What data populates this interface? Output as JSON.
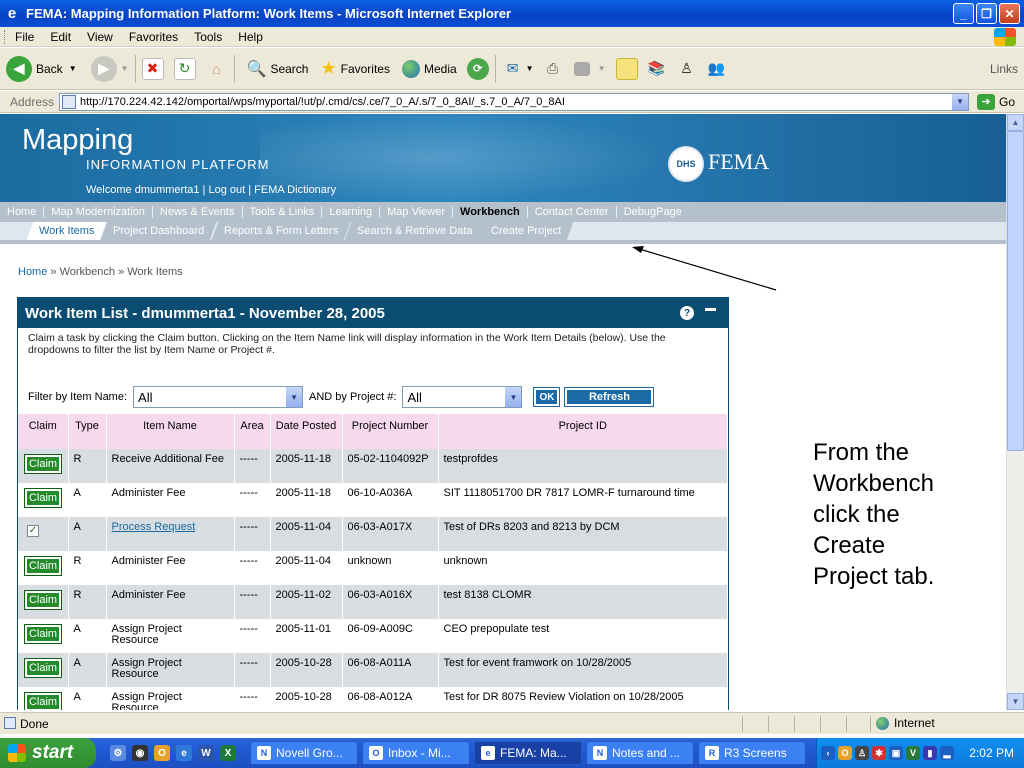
{
  "window": {
    "title": "FEMA: Mapping Information Platform: Work Items - Microsoft Internet Explorer"
  },
  "menu": [
    "File",
    "Edit",
    "View",
    "Favorites",
    "Tools",
    "Help"
  ],
  "toolbar": {
    "back": "Back",
    "search": "Search",
    "favorites": "Favorites",
    "media": "Media",
    "links": "Links"
  },
  "address": {
    "label": "Address",
    "url": "http://170.224.42.142/omportal/wps/myportal/!ut/p/.cmd/cs/.ce/7_0_A/.s/7_0_8AI/_s.7_0_A/7_0_8AI",
    "go": "Go"
  },
  "banner": {
    "title": "Mapping",
    "subtitle": "INFORMATION PLATFORM",
    "welcome": "Welcome dmummerta1",
    "logout": "Log out",
    "dictionary": "FEMA Dictionary",
    "agency": "FEMA"
  },
  "mainnav": [
    "Home",
    "Map Modernization",
    "News & Events",
    "Tools & Links",
    "Learning",
    "Map Viewer",
    "Workbench",
    "Contact Center",
    "DebugPage"
  ],
  "subnav": [
    "Work Items",
    "Project Dashboard",
    "Reports & Form Letters",
    "Search & Retrieve Data",
    "Create Project"
  ],
  "breadcrumb": {
    "home": "Home",
    "rest": "» Workbench » Work Items"
  },
  "workitems": {
    "title": "Work Item List - dmummerta1 - November 28, 2005",
    "instructions": "Claim a task by clicking the Claim button. Clicking on the Item Name link will display information in the Work Item Details (below). Use the dropdowns to filter the list by Item Name or Project #.",
    "filter_label": "Filter by Item Name:",
    "filter_value": "All",
    "project_label": "AND by Project #:",
    "project_value": "All",
    "ok": "OK",
    "refresh": "Refresh",
    "columns": [
      "Claim",
      "Type",
      "Item Name",
      "Area",
      "Date Posted",
      "Project Number",
      "Project ID"
    ],
    "claim_label": "Claim",
    "rows": [
      {
        "type": "R",
        "name": "Receive Additional Fee",
        "area": "-----",
        "date": "2005-11-18",
        "number": "05-02-1104092P",
        "pid": "testprofdes",
        "claimed": false,
        "link": false
      },
      {
        "type": "A",
        "name": "Administer Fee",
        "area": "-----",
        "date": "2005-11-18",
        "number": "06-10-A036A",
        "pid": "SIT 1118051700 DR 7817 LOMR-F turnaround time",
        "claimed": false,
        "link": false
      },
      {
        "type": "A",
        "name": "Process Request",
        "area": "-----",
        "date": "2005-11-04",
        "number": "06-03-A017X",
        "pid": "Test of DRs 8203 and 8213 by DCM",
        "claimed": true,
        "link": true
      },
      {
        "type": "R",
        "name": "Administer Fee",
        "area": "-----",
        "date": "2005-11-04",
        "number": "unknown",
        "pid": "unknown",
        "claimed": false,
        "link": false
      },
      {
        "type": "R",
        "name": "Administer Fee",
        "area": "-----",
        "date": "2005-11-02",
        "number": "06-03-A016X",
        "pid": "test 8138 CLOMR",
        "claimed": false,
        "link": false
      },
      {
        "type": "A",
        "name": "Assign Project Resource",
        "area": "-----",
        "date": "2005-11-01",
        "number": "06-09-A009C",
        "pid": "CEO prepopulate test",
        "claimed": false,
        "link": false
      },
      {
        "type": "A",
        "name": "Assign Project Resource",
        "area": "-----",
        "date": "2005-10-28",
        "number": "06-08-A011A",
        "pid": "Test for event framwork on 10/28/2005",
        "claimed": false,
        "link": false
      },
      {
        "type": "A",
        "name": "Assign Project Resource",
        "area": "-----",
        "date": "2005-10-28",
        "number": "06-08-A012A",
        "pid": "Test for DR 8075 Review Violation on 10/28/2005",
        "claimed": false,
        "link": false
      }
    ]
  },
  "annotation": "From the Workbench click the Create Project tab.",
  "status": {
    "text": "Done",
    "zone": "Internet"
  },
  "taskbar": {
    "start": "start",
    "tasks": [
      "Novell Gro...",
      "Inbox - Mi...",
      "FEMA: Ma...",
      "Notes and ...",
      "R3 Screens"
    ],
    "active": 2,
    "clock": "2:02 PM"
  }
}
